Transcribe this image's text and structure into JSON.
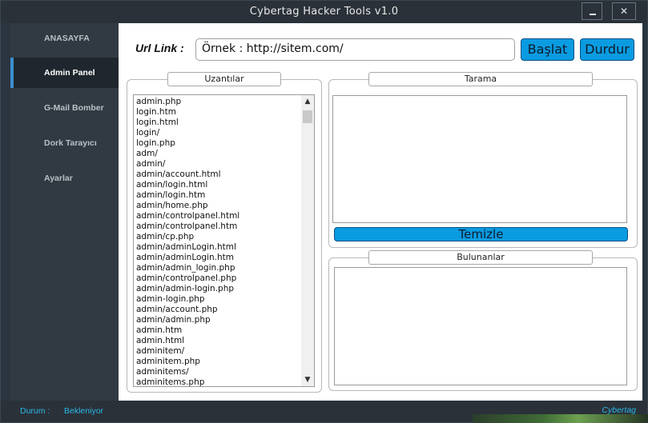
{
  "window": {
    "title": "Cybertag Hacker Tools v1.0",
    "minimize_icon": "minimize-icon",
    "close_label": "✕"
  },
  "sidebar": {
    "items": [
      {
        "label": "ANASAYFA",
        "active": false
      },
      {
        "label": "Admin Panel",
        "active": true
      },
      {
        "label": "G-Mail Bomber",
        "active": false
      },
      {
        "label": "Dork Tarayıcı",
        "active": false
      },
      {
        "label": "Ayarlar",
        "active": false
      }
    ]
  },
  "url": {
    "label": "Url Link :",
    "value": "Örnek : http://sitem.com/"
  },
  "buttons": {
    "start": "Başlat",
    "stop": "Durdur",
    "clear": "Temizle"
  },
  "extensions": {
    "title": "Uzantılar",
    "items": [
      "admin.php",
      "login.htm",
      "login.html",
      "login/",
      "login.php",
      "adm/",
      "admin/",
      "admin/account.html",
      "admin/login.html",
      "admin/login.htm",
      "admin/home.php",
      "admin/controlpanel.html",
      "admin/controlpanel.htm",
      "admin/cp.php",
      "admin/adminLogin.html",
      "admin/adminLogin.htm",
      "admin/admin_login.php",
      "admin/controlpanel.php",
      "admin/admin-login.php",
      "admin-login.php",
      "admin/account.php",
      "admin/admin.php",
      "admin.htm",
      "admin.html",
      "adminitem/",
      "adminitem.php",
      "adminitems/",
      "adminitems.php"
    ]
  },
  "scan": {
    "title": "Tarama"
  },
  "found": {
    "title": "Bulunanlar"
  },
  "status": {
    "label": "Durum :",
    "value": "Bekleniyor",
    "brand": "Cybertag"
  },
  "colors": {
    "accent": "#0a9be0",
    "status_text": "#2ab8e8",
    "sidebar_bg": "#313a43",
    "active_indicator": "#3b8fd0"
  }
}
